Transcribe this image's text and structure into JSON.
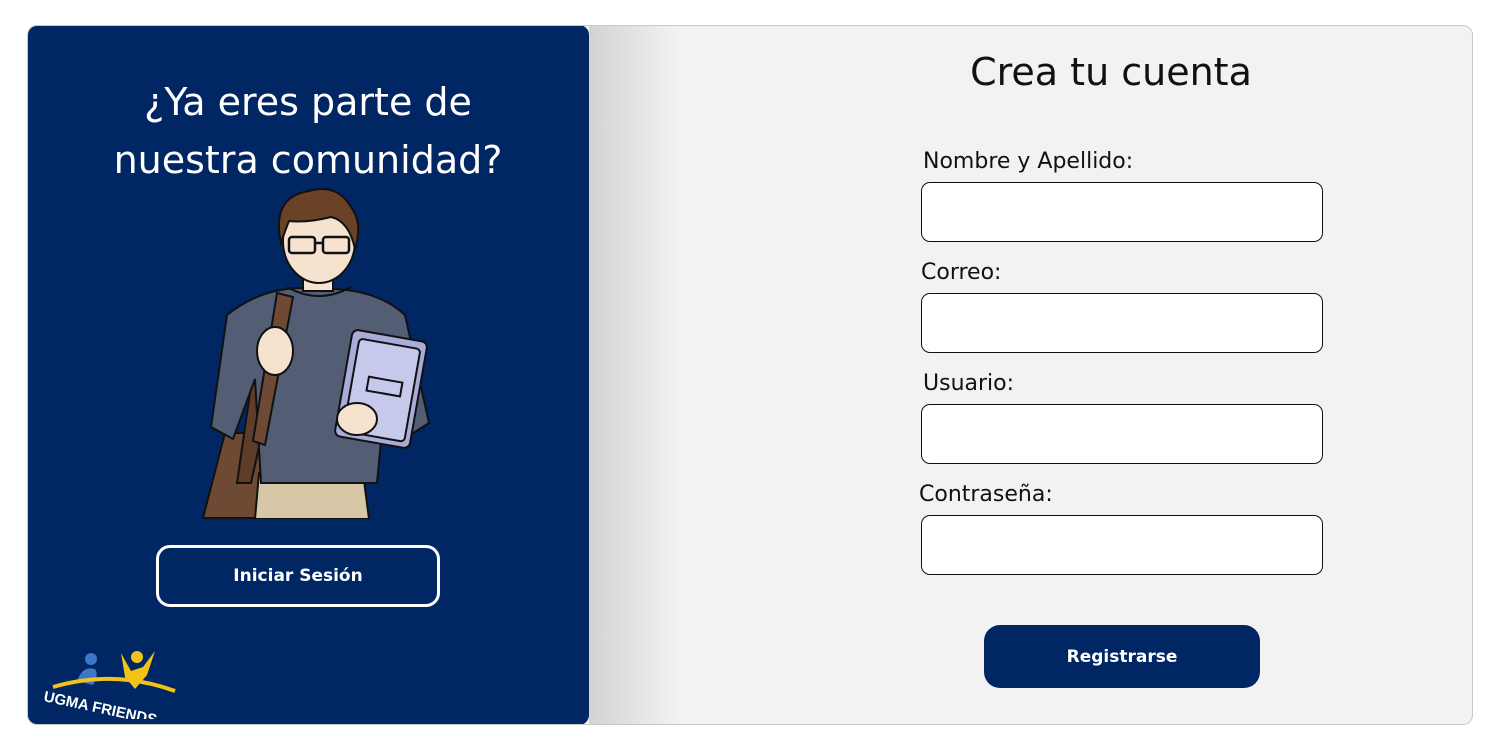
{
  "left_panel": {
    "heading_line1": "¿Ya eres parte de",
    "heading_line2": "nuestra comunidad?",
    "login_button_label": "Iniciar Sesión",
    "logo_text": "UGMA FRIENDS"
  },
  "form": {
    "title": "Crea tu cuenta",
    "fields": [
      {
        "label": "Nombre  y Apellido:",
        "value": ""
      },
      {
        "label": "Correo:",
        "value": ""
      },
      {
        "label": "Usuario:",
        "value": ""
      },
      {
        "label": "Contraseña:",
        "value": ""
      }
    ],
    "submit_label": "Registrarse"
  },
  "colors": {
    "brand_navy": "#002763",
    "background_gray": "#f2f2f2",
    "logo_yellow": "#f2c218",
    "logo_blue": "#3b78c9"
  }
}
